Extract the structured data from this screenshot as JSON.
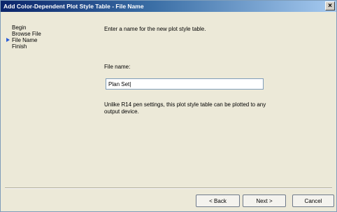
{
  "window": {
    "title": "Add Color-Dependent Plot Style Table - File Name"
  },
  "steps": [
    {
      "label": "Begin"
    },
    {
      "label": "Browse File"
    },
    {
      "label": "File Name"
    },
    {
      "label": "Finish"
    }
  ],
  "main": {
    "intro": "Enter a name for the new plot style table.",
    "field_label": "File name:",
    "input_value": "Plan Set|",
    "note": "Unlike R14 pen settings, this plot style table can be plotted to any output device."
  },
  "buttons": {
    "back": "< Back",
    "next": "Next >",
    "cancel": "Cancel"
  }
}
